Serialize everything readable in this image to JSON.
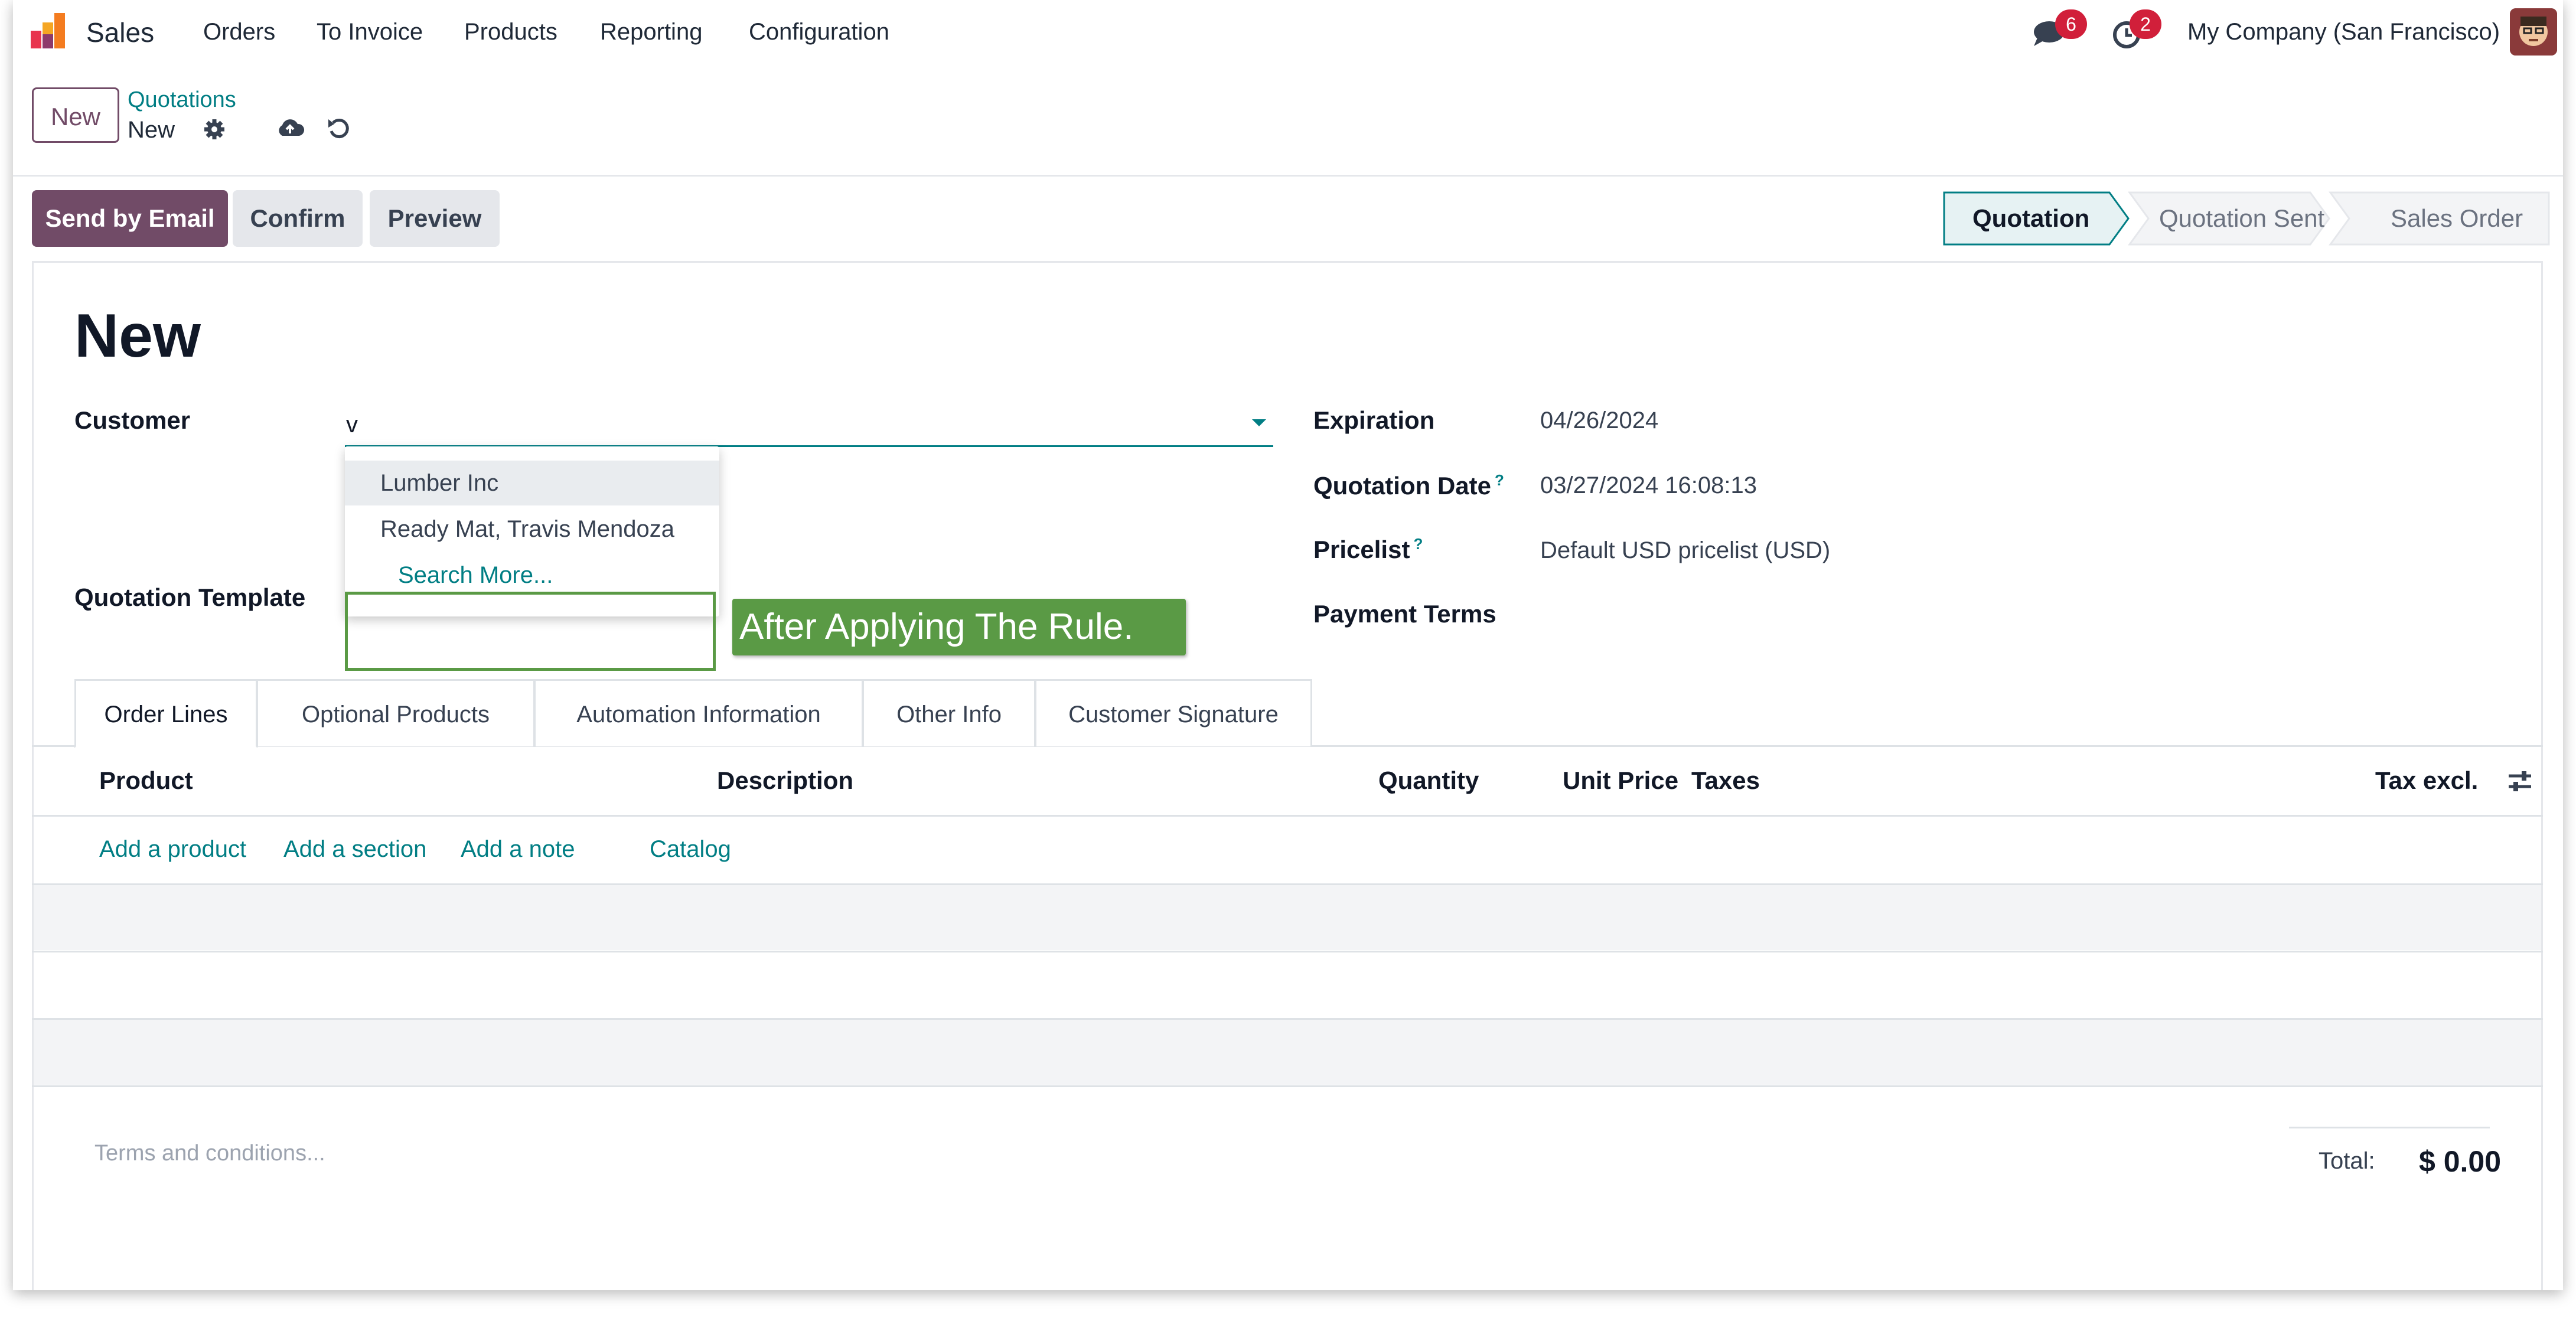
{
  "navbar": {
    "app_name": "Sales",
    "menus": [
      "Orders",
      "To Invoice",
      "Products",
      "Reporting",
      "Configuration"
    ],
    "messages_count": "6",
    "activities_count": "2",
    "company": "My Company (San Francisco)"
  },
  "control_panel": {
    "new_button": "New",
    "breadcrumb_parent": "Quotations",
    "breadcrumb_current": "New"
  },
  "actions": {
    "send_by_email": "Send by Email",
    "confirm": "Confirm",
    "preview": "Preview"
  },
  "statusbar": {
    "stages": [
      "Quotation",
      "Quotation Sent",
      "Sales Order"
    ],
    "active_stage": "Quotation"
  },
  "form": {
    "title": "New",
    "customer_label": "Customer",
    "customer_value": "v",
    "quotation_template_label": "Quotation Template",
    "expiration_label": "Expiration",
    "expiration_value": "04/26/2024",
    "quotation_date_label": "Quotation Date",
    "quotation_date_value": "03/27/2024 16:08:13",
    "pricelist_label": "Pricelist",
    "pricelist_value": "Default USD pricelist (USD)",
    "payment_terms_label": "Payment Terms",
    "help_mark": "?"
  },
  "autocomplete": {
    "items": [
      "Lumber Inc",
      "Ready Mat, Travis Mendoza"
    ],
    "search_more": "Search More..."
  },
  "annotation": {
    "tooltip": "After Applying The Rule.",
    "highlight_color": "#5a9a45"
  },
  "tabs": [
    "Order Lines",
    "Optional Products",
    "Automation Information",
    "Other Info",
    "Customer Signature"
  ],
  "order_lines": {
    "columns": {
      "product": "Product",
      "description": "Description",
      "quantity": "Quantity",
      "unit_price": "Unit Price",
      "taxes": "Taxes",
      "tax_excl": "Tax excl."
    },
    "add_product": "Add a product",
    "add_section": "Add a section",
    "add_note": "Add a note",
    "catalog": "Catalog"
  },
  "footer": {
    "terms_placeholder": "Terms and conditions...",
    "total_label": "Total:",
    "total_value": "$ 0.00"
  },
  "colors": {
    "brand": "#714b67",
    "accent": "#017e84",
    "badge": "#d11f3a"
  }
}
